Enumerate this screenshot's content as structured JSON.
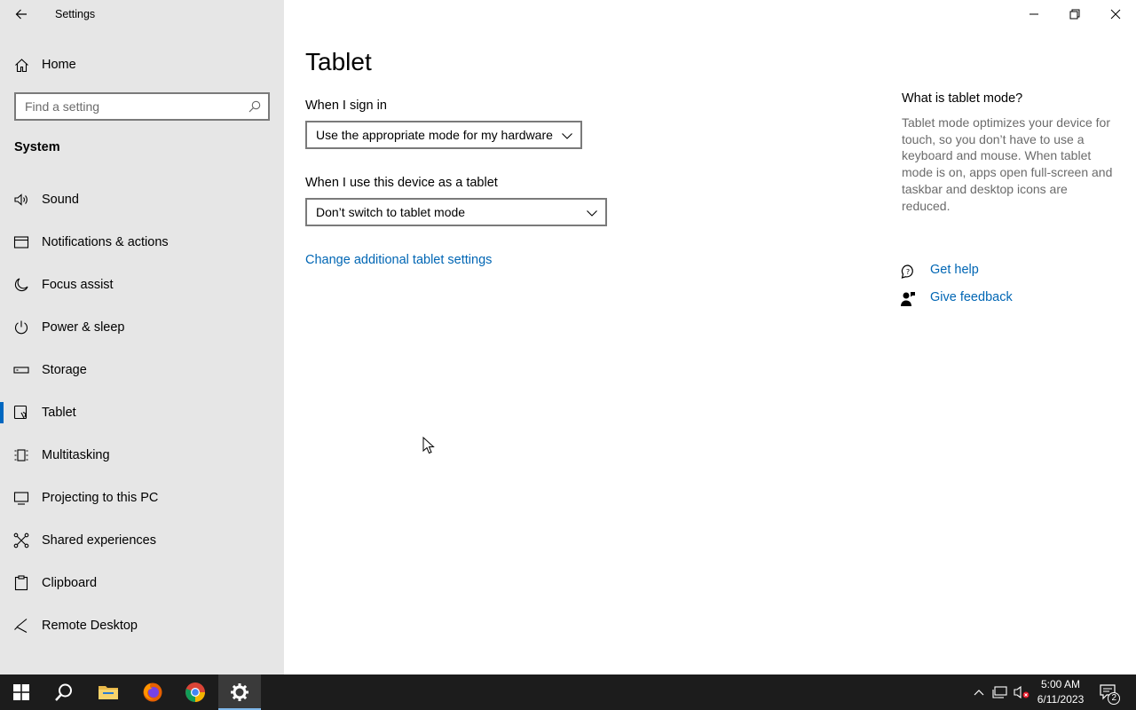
{
  "app": {
    "title": "Settings"
  },
  "sidebar": {
    "home_label": "Home",
    "search_placeholder": "Find a setting",
    "section_title": "System",
    "items": [
      {
        "label": "Sound",
        "icon": "speaker-icon"
      },
      {
        "label": "Notifications & actions",
        "icon": "notifications-icon"
      },
      {
        "label": "Focus assist",
        "icon": "moon-icon"
      },
      {
        "label": "Power & sleep",
        "icon": "power-icon"
      },
      {
        "label": "Storage",
        "icon": "storage-icon"
      },
      {
        "label": "Tablet",
        "icon": "tablet-icon",
        "selected": true
      },
      {
        "label": "Multitasking",
        "icon": "multitasking-icon"
      },
      {
        "label": "Projecting to this PC",
        "icon": "projecting-icon"
      },
      {
        "label": "Shared experiences",
        "icon": "shared-experiences-icon"
      },
      {
        "label": "Clipboard",
        "icon": "clipboard-icon"
      },
      {
        "label": "Remote Desktop",
        "icon": "remote-desktop-icon"
      }
    ]
  },
  "main": {
    "title": "Tablet",
    "sign_in": {
      "label": "When I sign in",
      "value": "Use the appropriate mode for my hardware"
    },
    "tablet_use": {
      "label": "When I use this device as a tablet",
      "value": "Don’t switch to tablet mode"
    },
    "additional_link": "Change additional tablet settings"
  },
  "aside": {
    "title": "What is tablet mode?",
    "description": "Tablet mode optimizes your device for touch, so you don’t have to use a keyboard and mouse. When tablet mode is on, apps open full-screen and taskbar and desktop icons are reduced.",
    "get_help": "Get help",
    "give_feedback": "Give feedback"
  },
  "taskbar": {
    "time": "5:00 AM",
    "date": "6/11/2023",
    "notification_count": "2",
    "accent_color": "#7fb8ea"
  },
  "colors": {
    "sidebar_bg": "#e6e6e6",
    "link": "#0066b4",
    "selection_bar": "#0067c0",
    "taskbar_bg": "#1c1c1c"
  }
}
